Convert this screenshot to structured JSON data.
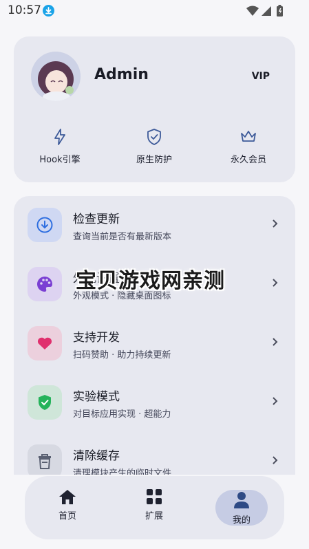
{
  "status_bar": {
    "time": "10:57"
  },
  "profile": {
    "username": "Admin",
    "badge": "VIP",
    "features": [
      {
        "label": "Hook引擎",
        "icon": "lightning-icon"
      },
      {
        "label": "原生防护",
        "icon": "shield-check-icon"
      },
      {
        "label": "永久会员",
        "icon": "crown-icon"
      }
    ]
  },
  "menu": {
    "items": [
      {
        "title": "检查更新",
        "subtitle": "查询当前是否有最新版本",
        "icon": "download-icon",
        "color": "#2f6fe0",
        "bg": "#cfd8f3"
      },
      {
        "title": "外观设置",
        "subtitle": "外观模式 · 隐藏桌面图标",
        "icon": "palette-icon",
        "color": "#7a3fd3",
        "bg": "#ddd3f1"
      },
      {
        "title": "支持开发",
        "subtitle": "扫码赞助 · 助力持续更新",
        "icon": "heart-icon",
        "color": "#e0306e",
        "bg": "#ecd0dd"
      },
      {
        "title": "实验模式",
        "subtitle": "对目标应用实现 · 超能力",
        "icon": "shield-check-icon",
        "color": "#25b35b",
        "bg": "#cfe6d9"
      },
      {
        "title": "清除缓存",
        "subtitle": "清理模块产生的临时文件",
        "icon": "trash-icon",
        "color": "#5a6072",
        "bg": "#d7d9e2"
      }
    ]
  },
  "watermark": "宝贝游戏网亲测",
  "nav": {
    "tabs": [
      {
        "label": "首页",
        "icon": "home-icon"
      },
      {
        "label": "扩展",
        "icon": "grid-icon"
      },
      {
        "label": "我的",
        "icon": "person-icon",
        "active": true
      }
    ]
  }
}
